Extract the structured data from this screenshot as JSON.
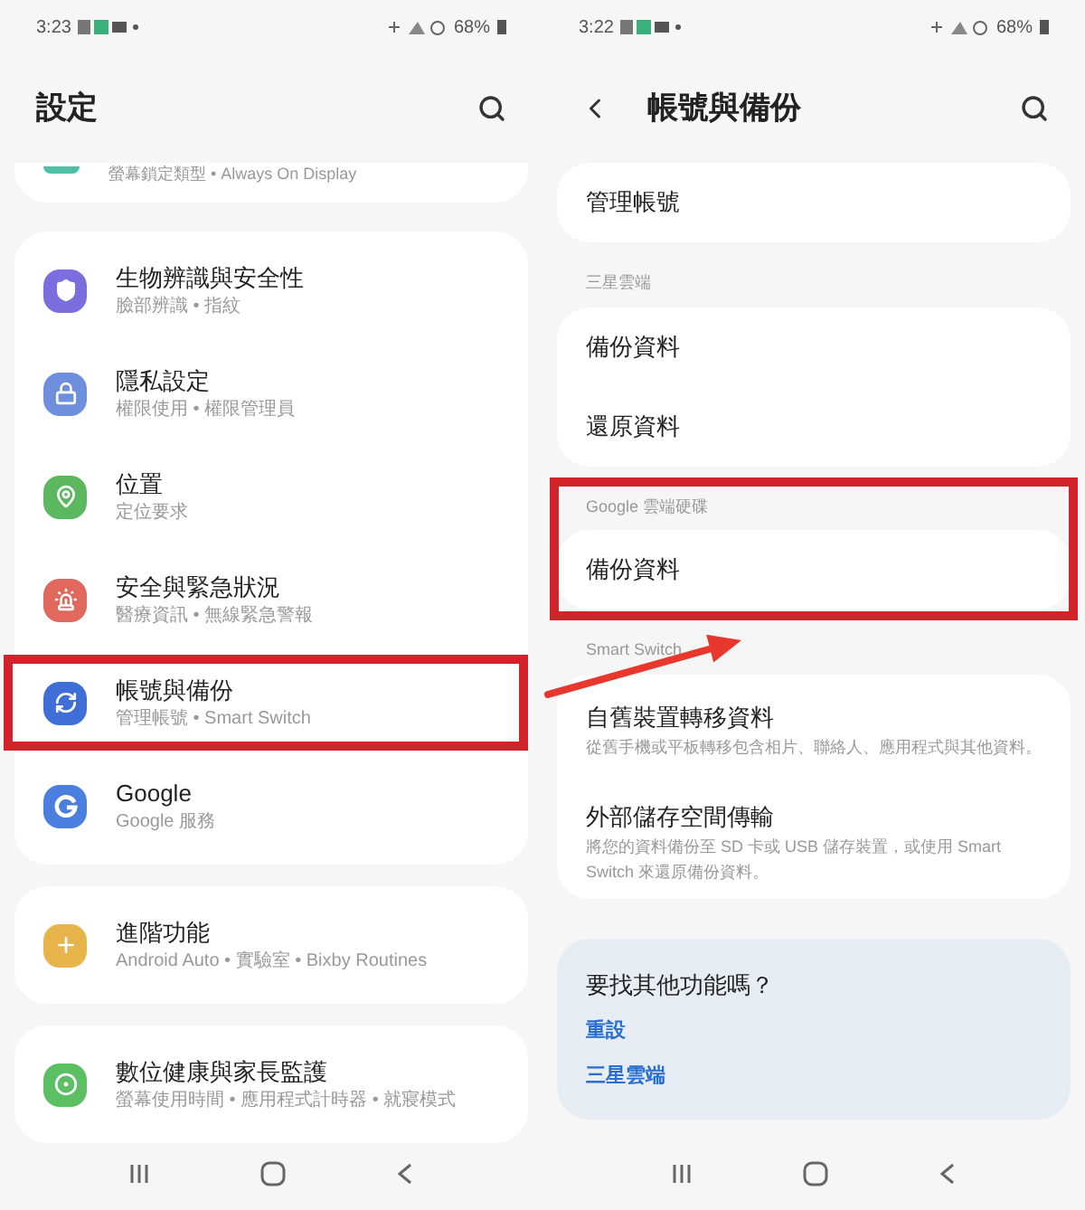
{
  "left_screen": {
    "status_bar": {
      "time": "3:23",
      "battery": "68%"
    },
    "title": "設定",
    "partial_item": {
      "subtitle": "螢幕鎖定類型 • Always On Display",
      "color": "#4fbfa8"
    },
    "groups": [
      {
        "items": [
          {
            "kind": "shield",
            "color": "#7b6fe0",
            "title": "生物辨識與安全性",
            "subtitle": "臉部辨識 • 指紋",
            "highlighted": false
          },
          {
            "kind": "lock",
            "color": "#6e8fdc",
            "title": "隱私設定",
            "subtitle": "權限使用 • 權限管理員",
            "highlighted": false
          },
          {
            "kind": "pin",
            "color": "#5cb85f",
            "title": "位置",
            "subtitle": "定位要求",
            "highlighted": false
          },
          {
            "kind": "alert",
            "color": "#e0685c",
            "title": "安全與緊急狀況",
            "subtitle": "醫療資訊 • 無線緊急警報",
            "highlighted": false
          },
          {
            "kind": "sync",
            "color": "#3f6fd6",
            "title": "帳號與備份",
            "subtitle": "管理帳號 • Smart Switch",
            "highlighted": true
          },
          {
            "kind": "g",
            "color": "#4a7fe0",
            "title": "Google",
            "subtitle": "Google 服務",
            "highlighted": false
          }
        ]
      },
      {
        "items": [
          {
            "kind": "plus",
            "color": "#e6b44a",
            "title": "進階功能",
            "subtitle": "Android Auto • 實驗室 • Bixby Routines",
            "highlighted": false
          }
        ]
      },
      {
        "items": [
          {
            "kind": "ring",
            "color": "#5cbf64",
            "title": "數位健康與家長監護",
            "subtitle": "螢幕使用時間 • 應用程式計時器 • 就寢模式",
            "highlighted": false
          }
        ]
      }
    ]
  },
  "right_screen": {
    "status_bar": {
      "time": "3:22",
      "battery": "68%"
    },
    "title": "帳號與備份",
    "sections": [
      {
        "highlighted": false,
        "items": [
          {
            "title": "管理帳號"
          }
        ]
      },
      {
        "header": "三星雲端",
        "highlighted": false,
        "items": [
          {
            "title": "備份資料"
          },
          {
            "title": "還原資料"
          }
        ]
      },
      {
        "header": "Google 雲端硬碟",
        "highlighted": true,
        "items": [
          {
            "title": "備份資料"
          }
        ]
      },
      {
        "header": "Smart Switch",
        "highlighted": false,
        "items": [
          {
            "title": "自舊裝置轉移資料",
            "subtitle": "從舊手機或平板轉移包含相片、聯絡人、應用程式與其他資料。"
          },
          {
            "title": "外部儲存空間傳輸",
            "subtitle": "將您的資料備份至 SD 卡或 USB 儲存裝置，或使用 Smart Switch 來還原備份資料。"
          }
        ]
      }
    ],
    "suggestions": {
      "title": "要找其他功能嗎？",
      "links": [
        "重設",
        "三星雲端"
      ]
    }
  }
}
